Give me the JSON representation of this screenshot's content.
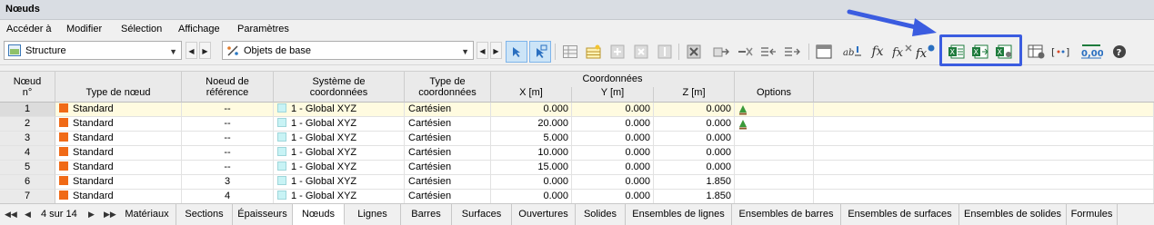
{
  "window": {
    "title": "Nœuds"
  },
  "menu": [
    "Accéder à",
    "Modifier",
    "Sélection",
    "Affichage",
    "Paramètres"
  ],
  "toolbar": {
    "combo1": "Structure",
    "combo2": "Objets de base",
    "zero_label": "0,00"
  },
  "table": {
    "headers": {
      "node": "Nœud\nn°",
      "type": "Type de nœud",
      "ref": "Noeud de\nréférence",
      "system": "Système de\ncoordonnées",
      "ctype": "Type de\ncoordonnées",
      "coords_group": "Coordonnées",
      "x": "X [m]",
      "y": "Y [m]",
      "z": "Z [m]",
      "options": "Options"
    },
    "rows": [
      {
        "no": "1",
        "type": "Standard",
        "ref": "--",
        "system": "1 - Global XYZ",
        "ctype": "Cartésien",
        "x": "0.000",
        "y": "0.000",
        "z": "0.000",
        "support": true
      },
      {
        "no": "2",
        "type": "Standard",
        "ref": "--",
        "system": "1 - Global XYZ",
        "ctype": "Cartésien",
        "x": "20.000",
        "y": "0.000",
        "z": "0.000",
        "support": true
      },
      {
        "no": "3",
        "type": "Standard",
        "ref": "--",
        "system": "1 - Global XYZ",
        "ctype": "Cartésien",
        "x": "5.000",
        "y": "0.000",
        "z": "0.000",
        "support": false
      },
      {
        "no": "4",
        "type": "Standard",
        "ref": "--",
        "system": "1 - Global XYZ",
        "ctype": "Cartésien",
        "x": "10.000",
        "y": "0.000",
        "z": "0.000",
        "support": false
      },
      {
        "no": "5",
        "type": "Standard",
        "ref": "--",
        "system": "1 - Global XYZ",
        "ctype": "Cartésien",
        "x": "15.000",
        "y": "0.000",
        "z": "0.000",
        "support": false
      },
      {
        "no": "6",
        "type": "Standard",
        "ref": "3",
        "system": "1 - Global XYZ",
        "ctype": "Cartésien",
        "x": "0.000",
        "y": "0.000",
        "z": "1.850",
        "support": false
      },
      {
        "no": "7",
        "type": "Standard",
        "ref": "4",
        "system": "1 - Global XYZ",
        "ctype": "Cartésien",
        "x": "0.000",
        "y": "0.000",
        "z": "1.850",
        "support": false
      }
    ]
  },
  "tabs": {
    "pager": "4 sur 14",
    "items": [
      "Matériaux",
      "Sections",
      "Épaisseurs",
      "Nœuds",
      "Lignes",
      "Barres",
      "Surfaces",
      "Ouvertures",
      "Solides",
      "Ensembles de lignes",
      "Ensembles de barres",
      "Ensembles de surfaces",
      "Ensembles de solides",
      "Formules"
    ],
    "active": "Nœuds"
  },
  "colors": {
    "accent_highlight": "#3b5ce0",
    "node_type": "#f06a17",
    "system_swatch": "#c8f3f5"
  }
}
